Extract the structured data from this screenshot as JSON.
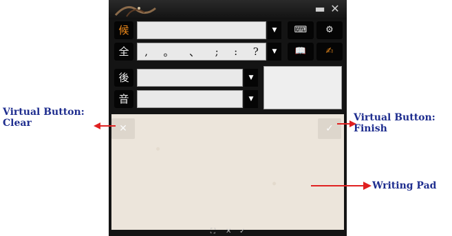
{
  "window": {
    "minimize_icon": "minimize-icon",
    "close_icon": "close-icon",
    "minimize_glyph": "▬",
    "close_glyph": "✕"
  },
  "candidate_row": {
    "label": "候",
    "value": "",
    "dropdown_glyph": "▼"
  },
  "punctuation_row": {
    "label": "全",
    "symbols": [
      ",",
      "。",
      "、",
      ";",
      ":",
      "?"
    ],
    "dropdown_glyph": "▼"
  },
  "toolbar": {
    "keyboard_glyph": "⌨",
    "settings_glyph": "⚙",
    "dictionary_glyph": "📖",
    "write_glyph": "✍"
  },
  "after_row": {
    "label": "後",
    "value": "",
    "dropdown_glyph": "▼"
  },
  "phonetic_row": {
    "label": "音",
    "value": "",
    "dropdown_glyph": "▼"
  },
  "writing_pad": {
    "clear_glyph": "✕",
    "finish_glyph": "✓"
  },
  "bottom_bar": {
    "icons": [
      "⛶",
      "✕",
      "✓"
    ]
  },
  "annotations": {
    "clear": "Virtual Button:\nClear",
    "finish": "Virtual Button:\nFinish",
    "pad": "Writing Pad"
  },
  "colors": {
    "accent_orange": "#f08a1a",
    "annotation_blue": "#1f2e8f",
    "arrow_red": "#e02020"
  }
}
